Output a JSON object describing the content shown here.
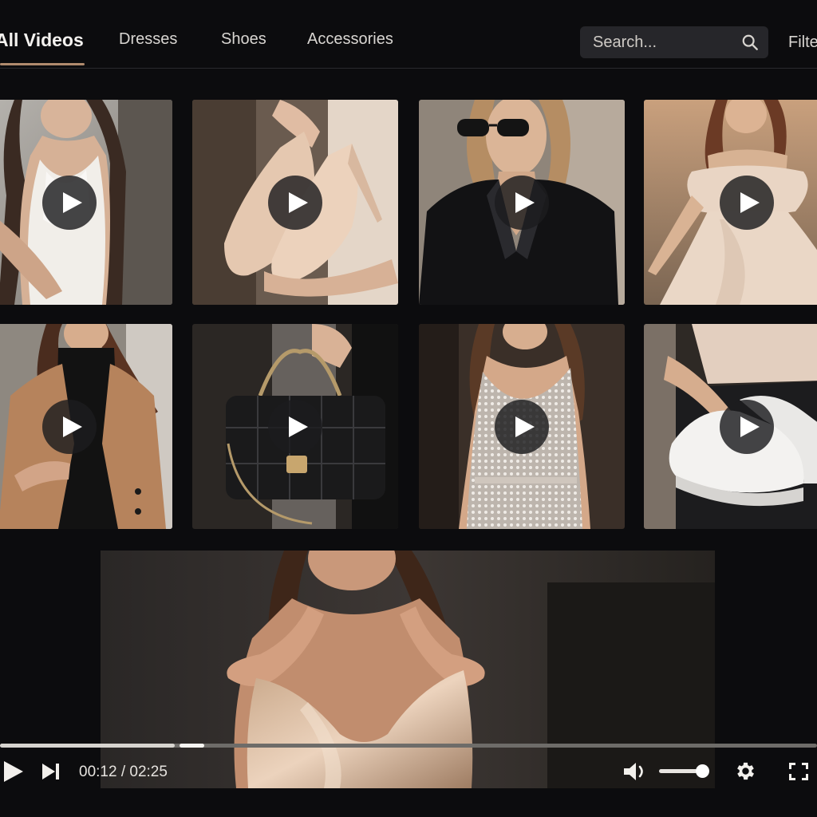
{
  "nav": {
    "tabs": [
      {
        "label": "All Videos",
        "active": true
      },
      {
        "label": "Dresses",
        "active": false
      },
      {
        "label": "Shoes",
        "active": false
      },
      {
        "label": "Accessories",
        "active": false
      }
    ],
    "search_placeholder": "Search...",
    "filter_label": "Filter"
  },
  "icons": {
    "search": "search-icon",
    "play": "play-icon",
    "skip_next": "skip-next-icon",
    "volume": "volume-icon",
    "settings": "gear-icon",
    "fullscreen": "fullscreen-icon"
  },
  "grid": {
    "tiles": [
      {
        "subject": "white satin slip dress"
      },
      {
        "subject": "nude high heel sandals"
      },
      {
        "subject": "black blazer with sunglasses"
      },
      {
        "subject": "off-shoulder beige dress"
      },
      {
        "subject": "camel wool coat"
      },
      {
        "subject": "black quilted handbag"
      },
      {
        "subject": "silver sequin dress"
      },
      {
        "subject": "white sneakers"
      }
    ]
  },
  "player": {
    "current_time": "00:12",
    "duration": "02:25",
    "time_separator": " / ",
    "progress": 0.214,
    "buffered_end": 0.25,
    "volume": 0.85
  },
  "colors": {
    "background": "#0c0c0e",
    "accent_underline": "#b08b6e",
    "search_bg": "#26262a"
  }
}
